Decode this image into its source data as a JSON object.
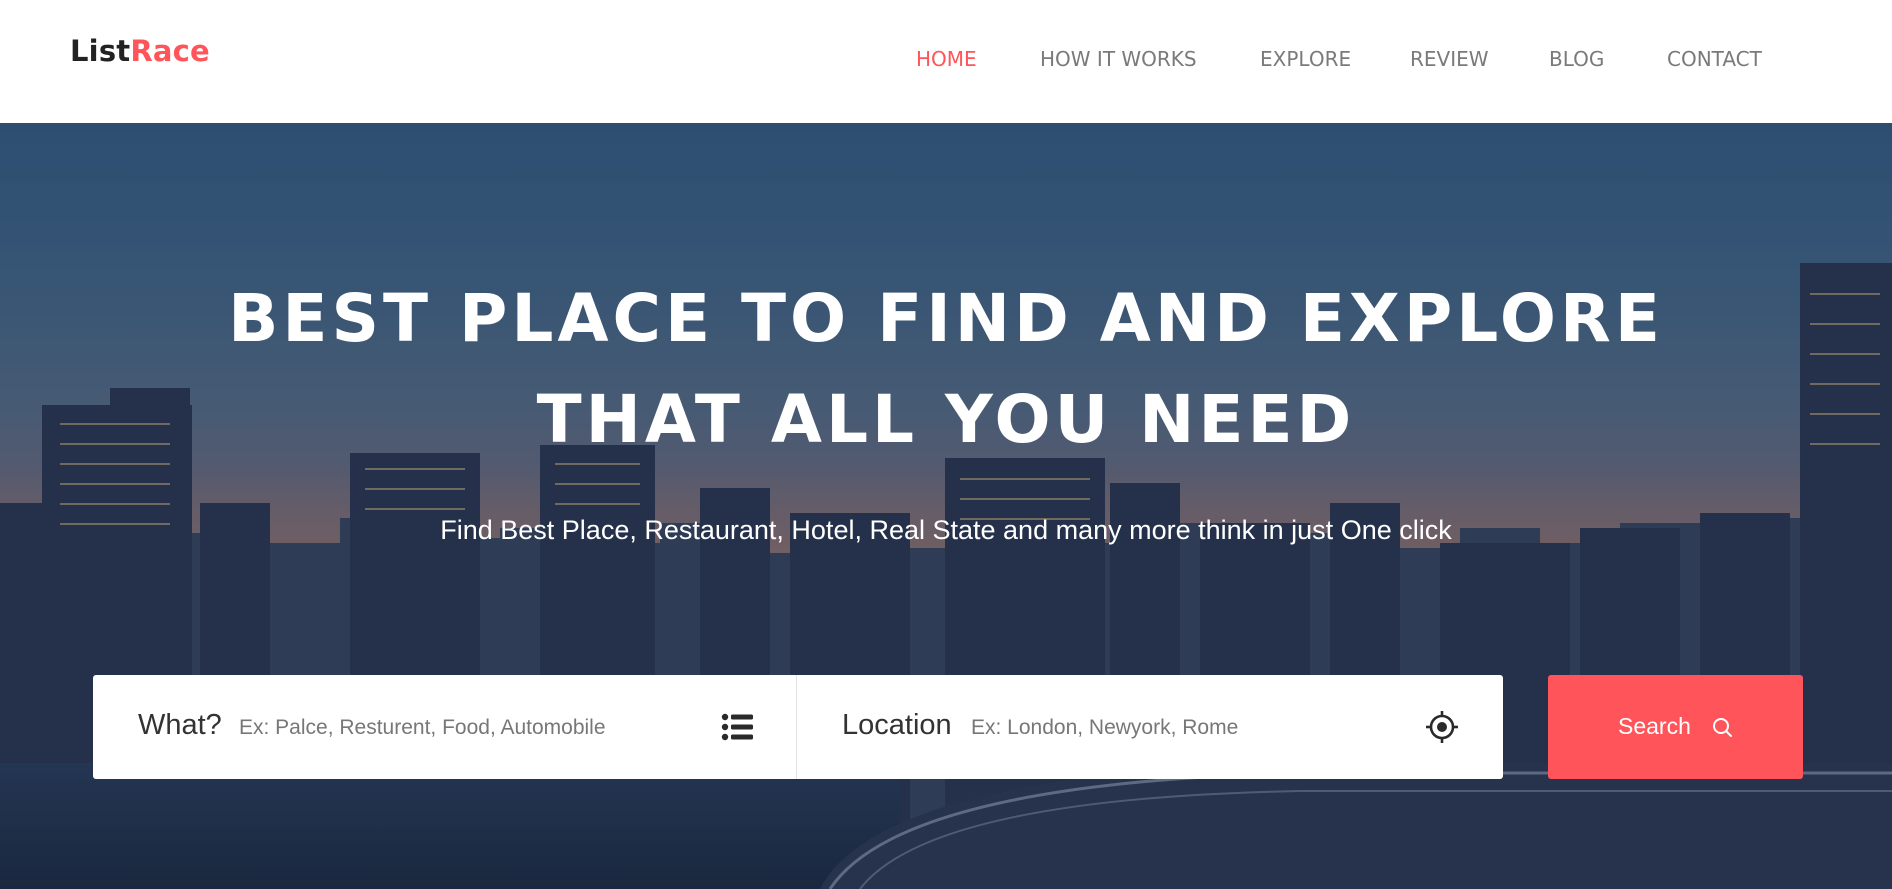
{
  "brand": {
    "logo_primary": "List",
    "logo_accent": "Race",
    "accent_color": "#ff545a"
  },
  "nav": {
    "items": [
      {
        "label": "HOME",
        "active": true
      },
      {
        "label": "HOW IT WORKS",
        "active": false
      },
      {
        "label": "EXPLORE",
        "active": false
      },
      {
        "label": "REVIEW",
        "active": false
      },
      {
        "label": "BLOG",
        "active": false
      },
      {
        "label": "CONTACT",
        "active": false
      }
    ]
  },
  "hero": {
    "headline_line1": "BEST PLACE TO FIND AND EXPLORE",
    "headline_line2": "THAT ALL YOU NEED",
    "subtitle": "Find Best Place, Restaurant, Hotel, Real State and many more think in just One click"
  },
  "search": {
    "what_label": "What?",
    "what_placeholder": "Ex: Palce, Resturent, Food, Automobile",
    "what_icon": "list-icon",
    "location_label": "Location",
    "location_placeholder": "Ex: London, Newyork, Rome",
    "location_icon": "crosshair-icon",
    "button_label": "Search",
    "button_icon": "search-icon"
  }
}
